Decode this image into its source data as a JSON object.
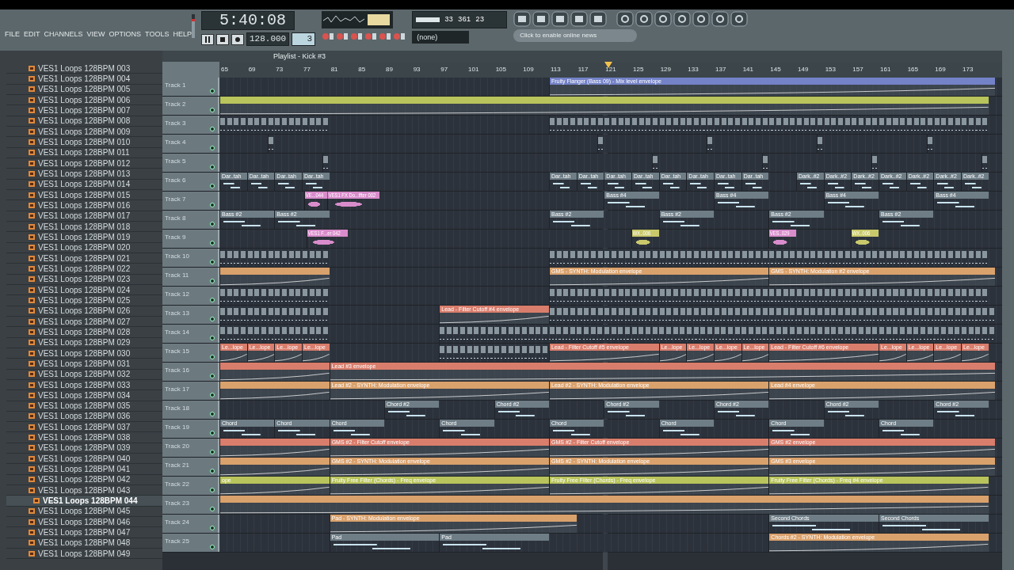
{
  "menu": [
    "FILE",
    "EDIT",
    "CHANNELS",
    "VIEW",
    "OPTIONS",
    "TOOLS",
    "HELP"
  ],
  "volume": {
    "level": 0.8
  },
  "time": "5:40:08",
  "tempo": "128.000",
  "pattern": "3",
  "cpu": {
    "a": "33",
    "b": "361",
    "c": "23"
  },
  "output": "(none)",
  "news": "Click to enable online news",
  "playlist_title": "Playlist - Kick #3",
  "browser": [
    {
      "name": "VES1 Loops 128BPM 003",
      "selected": false
    },
    {
      "name": "VES1 Loops 128BPM 004",
      "selected": false
    },
    {
      "name": "VES1 Loops 128BPM 005",
      "selected": false
    },
    {
      "name": "VES1 Loops 128BPM 006",
      "selected": false
    },
    {
      "name": "VES1 Loops 128BPM 007",
      "selected": false
    },
    {
      "name": "VES1 Loops 128BPM 008",
      "selected": false
    },
    {
      "name": "VES1 Loops 128BPM 009",
      "selected": false
    },
    {
      "name": "VES1 Loops 128BPM 010",
      "selected": false
    },
    {
      "name": "VES1 Loops 128BPM 011",
      "selected": false
    },
    {
      "name": "VES1 Loops 128BPM 012",
      "selected": false
    },
    {
      "name": "VES1 Loops 128BPM 013",
      "selected": false
    },
    {
      "name": "VES1 Loops 128BPM 014",
      "selected": false
    },
    {
      "name": "VES1 Loops 128BPM 015",
      "selected": false
    },
    {
      "name": "VES1 Loops 128BPM 016",
      "selected": false
    },
    {
      "name": "VES1 Loops 128BPM 017",
      "selected": false
    },
    {
      "name": "VES1 Loops 128BPM 018",
      "selected": false
    },
    {
      "name": "VES1 Loops 128BPM 019",
      "selected": false
    },
    {
      "name": "VES1 Loops 128BPM 020",
      "selected": false
    },
    {
      "name": "VES1 Loops 128BPM 021",
      "selected": false
    },
    {
      "name": "VES1 Loops 128BPM 022",
      "selected": false
    },
    {
      "name": "VES1 Loops 128BPM 023",
      "selected": false
    },
    {
      "name": "VES1 Loops 128BPM 024",
      "selected": false
    },
    {
      "name": "VES1 Loops 128BPM 025",
      "selected": false
    },
    {
      "name": "VES1 Loops 128BPM 026",
      "selected": false
    },
    {
      "name": "VES1 Loops 128BPM 027",
      "selected": false
    },
    {
      "name": "VES1 Loops 128BPM 028",
      "selected": false
    },
    {
      "name": "VES1 Loops 128BPM 029",
      "selected": false
    },
    {
      "name": "VES1 Loops 128BPM 030",
      "selected": false
    },
    {
      "name": "VES1 Loops 128BPM 031",
      "selected": false
    },
    {
      "name": "VES1 Loops 128BPM 032",
      "selected": false
    },
    {
      "name": "VES1 Loops 128BPM 033",
      "selected": false
    },
    {
      "name": "VES1 Loops 128BPM 034",
      "selected": false
    },
    {
      "name": "VES1 Loops 128BPM 035",
      "selected": false
    },
    {
      "name": "VES1 Loops 128BPM 036",
      "selected": false
    },
    {
      "name": "VES1 Loops 128BPM 037",
      "selected": false
    },
    {
      "name": "VES1 Loops 128BPM 038",
      "selected": false
    },
    {
      "name": "VES1 Loops 128BPM 039",
      "selected": false
    },
    {
      "name": "VES1 Loops 128BPM 040",
      "selected": false
    },
    {
      "name": "VES1 Loops 128BPM 041",
      "selected": false
    },
    {
      "name": "VES1 Loops 128BPM 042",
      "selected": false
    },
    {
      "name": "VES1 Loops 128BPM 043",
      "selected": false
    },
    {
      "name": "VES1 Loops 128BPM 044",
      "selected": true
    },
    {
      "name": "VES1 Loops 128BPM 045",
      "selected": false
    },
    {
      "name": "VES1 Loops 128BPM 046",
      "selected": false
    },
    {
      "name": "VES1 Loops 128BPM 047",
      "selected": false
    },
    {
      "name": "VES1 Loops 128BPM 048",
      "selected": false
    },
    {
      "name": "VES1 Loops 128BPM 049",
      "selected": false
    }
  ],
  "ruler": [
    "65",
    "69",
    "73",
    "77",
    "81",
    "85",
    "89",
    "93",
    "97",
    "101",
    "105",
    "109",
    "113",
    "117",
    "121",
    "125",
    "129",
    "133",
    "137",
    "141",
    "145",
    "149",
    "153",
    "157",
    "161",
    "165",
    "169",
    "173"
  ],
  "playhead": {
    "level": 0.497
  },
  "tracks": [
    {
      "name": "Track 1",
      "clips": [
        {
          "kind": "auto",
          "label": "Fruity Flanger (Bass 09) - Mix level envelope",
          "color": "#7482c8"
        }
      ]
    },
    {
      "name": "Track 2",
      "clips": [
        {
          "kind": "auto",
          "color": "#b9c45c"
        }
      ]
    },
    {
      "name": "Track 3",
      "clips": [
        {
          "kind": "blocks",
          "color": "#8a969e"
        },
        {
          "kind": "blocks",
          "color": "#8a969e"
        }
      ]
    },
    {
      "name": "Track 4",
      "clips": [
        {
          "kind": "blocks",
          "color": "#8a969e"
        },
        {
          "kind": "blocks",
          "color": "#8a969e"
        },
        {
          "kind": "blocks",
          "color": "#8a969e"
        },
        {
          "kind": "blocks",
          "color": "#8a969e"
        },
        {
          "kind": "blocks",
          "color": "#8a969e"
        }
      ]
    },
    {
      "name": "Track 5",
      "clips": [
        {
          "kind": "blocks",
          "color": "#8a969e"
        },
        {
          "kind": "blocks",
          "color": "#8a969e"
        },
        {
          "kind": "blocks",
          "color": "#8a969e"
        },
        {
          "kind": "blocks",
          "color": "#8a969e"
        },
        {
          "kind": "blocks",
          "color": "#8a969e"
        }
      ]
    },
    {
      "name": "Track 6",
      "clips": [
        {
          "kind": "pattern",
          "label": "Dar..tah",
          "color": "#6e7d86"
        },
        {
          "kind": "pattern",
          "label": "Dar..tah",
          "color": "#6e7d86"
        },
        {
          "kind": "pattern",
          "label": "Dar..tah",
          "color": "#6e7d86"
        },
        {
          "kind": "pattern",
          "label": "Dar..tah",
          "color": "#6e7d86"
        },
        {
          "kind": "pattern",
          "label": "Dar..tah",
          "color": "#6e7d86"
        },
        {
          "kind": "pattern",
          "label": "Dar..tah",
          "color": "#6e7d86"
        },
        {
          "kind": "pattern",
          "label": "Dar..tah",
          "color": "#6e7d86"
        },
        {
          "kind": "pattern",
          "label": "Dar..tah",
          "color": "#6e7d86"
        },
        {
          "kind": "pattern",
          "label": "Dar..tah",
          "color": "#6e7d86"
        },
        {
          "kind": "pattern",
          "label": "Dar..tah",
          "color": "#6e7d86"
        },
        {
          "kind": "pattern",
          "label": "Dar..tah",
          "color": "#6e7d86"
        },
        {
          "kind": "pattern",
          "label": "Dar..tah",
          "color": "#6e7d86"
        },
        {
          "kind": "pattern",
          "label": "Dark..#2",
          "color": "#6e7d86"
        },
        {
          "kind": "pattern",
          "label": "Dark..#2",
          "color": "#6e7d86"
        },
        {
          "kind": "pattern",
          "label": "Dark..#2",
          "color": "#6e7d86"
        },
        {
          "kind": "pattern",
          "label": "Dark..#2",
          "color": "#6e7d86"
        },
        {
          "kind": "pattern",
          "label": "Dark..#2",
          "color": "#6e7d86"
        },
        {
          "kind": "pattern",
          "label": "Dark..#2",
          "color": "#6e7d86"
        },
        {
          "kind": "pattern",
          "label": "Dark..#2",
          "color": "#6e7d86"
        }
      ]
    },
    {
      "name": "Track 7",
      "clips": [
        {
          "kind": "audio",
          "label": "VE...044",
          "color": "#d98ccb"
        },
        {
          "kind": "audio",
          "label": "VES1 FX Do...ffter 002",
          "color": "#d98ccb"
        },
        {
          "kind": "pattern",
          "label": "Bass #4",
          "color": "#6e7d86"
        },
        {
          "kind": "pattern",
          "label": "Bass #4",
          "color": "#6e7d86"
        },
        {
          "kind": "pattern",
          "label": "Bass #4",
          "color": "#6e7d86"
        },
        {
          "kind": "pattern",
          "label": "Bass #4",
          "color": "#6e7d86"
        }
      ]
    },
    {
      "name": "Track 8",
      "clips": [
        {
          "kind": "pattern",
          "label": "Bass #2",
          "color": "#6e7d86"
        },
        {
          "kind": "pattern",
          "label": "Bass #2",
          "color": "#6e7d86"
        },
        {
          "kind": "pattern",
          "label": "Bass #2",
          "color": "#6e7d86"
        },
        {
          "kind": "pattern",
          "label": "Bass #2",
          "color": "#6e7d86"
        },
        {
          "kind": "pattern",
          "label": "Bass #2",
          "color": "#6e7d86"
        },
        {
          "kind": "pattern",
          "label": "Bass #2",
          "color": "#6e7d86"
        }
      ]
    },
    {
      "name": "Track 9",
      "clips": [
        {
          "kind": "audio",
          "label": "VES1 F...er 042",
          "color": "#d98ccb"
        },
        {
          "kind": "audio",
          "label": "WX..006",
          "color": "#c9c96c"
        },
        {
          "kind": "audio",
          "label": "VES..029",
          "color": "#d98ccb"
        },
        {
          "kind": "audio",
          "label": "WX..006",
          "color": "#c9c96c"
        }
      ]
    },
    {
      "name": "Track 10",
      "clips": [
        {
          "kind": "blocks",
          "color": "#8a969e"
        },
        {
          "kind": "blocks",
          "color": "#8a969e"
        }
      ]
    },
    {
      "name": "Track 11",
      "clips": [
        {
          "kind": "auto",
          "color": "#d9a16c"
        },
        {
          "kind": "auto",
          "label": "GMS - SYNTH: Modulation envelope",
          "color": "#d9a16c"
        },
        {
          "kind": "auto",
          "label": "GMS - SYNTH: Modulation #2 envelope",
          "color": "#d9a16c"
        }
      ]
    },
    {
      "name": "Track 12",
      "clips": [
        {
          "kind": "blocks",
          "color": "#8a969e"
        },
        {
          "kind": "blocks",
          "color": "#8a969e"
        }
      ]
    },
    {
      "name": "Track 13",
      "clips": [
        {
          "kind": "blocks",
          "color": "#8a969e"
        },
        {
          "kind": "auto",
          "label": "Lead - Filter Cutoff #4 envelope",
          "color": "#d97d6c"
        },
        {
          "kind": "blocks",
          "color": "#8a969e"
        }
      ]
    },
    {
      "name": "Track 14",
      "clips": [
        {
          "kind": "blocks",
          "color": "#8a969e"
        },
        {
          "kind": "blocks",
          "color": "#8a969e"
        }
      ]
    },
    {
      "name": "Track 15",
      "clips": [
        {
          "kind": "auto",
          "label": "Le...lope",
          "color": "#d97d6c"
        },
        {
          "kind": "auto",
          "label": "Le...lope",
          "color": "#d97d6c"
        },
        {
          "kind": "auto",
          "label": "Le...lope",
          "color": "#d97d6c"
        },
        {
          "kind": "auto",
          "label": "Le...lope",
          "color": "#d97d6c"
        },
        {
          "kind": "blocks",
          "color": "#8a969e"
        },
        {
          "kind": "auto",
          "label": "Lead - Filter Cutoff #5 envelope",
          "color": "#d97d6c"
        },
        {
          "kind": "auto",
          "label": "Le...lope",
          "color": "#d97d6c"
        },
        {
          "kind": "auto",
          "label": "Le...lope",
          "color": "#d97d6c"
        },
        {
          "kind": "auto",
          "label": "Le...lope",
          "color": "#d97d6c"
        },
        {
          "kind": "auto",
          "label": "Le...lope",
          "color": "#d97d6c"
        },
        {
          "kind": "auto",
          "label": "Lead - Filter Cutoff #6 envelope",
          "color": "#d97d6c"
        },
        {
          "kind": "auto",
          "label": "Le...lope",
          "color": "#d97d6c"
        },
        {
          "kind": "auto",
          "label": "Le...lope",
          "color": "#d97d6c"
        },
        {
          "kind": "auto",
          "label": "Le...lope",
          "color": "#d97d6c"
        },
        {
          "kind": "auto",
          "label": "Le...lope",
          "color": "#d97d6c"
        }
      ]
    },
    {
      "name": "Track 16",
      "clips": [
        {
          "kind": "auto",
          "color": "#d97d6c"
        },
        {
          "kind": "auto",
          "label": "Lead #3 envelope",
          "color": "#d97d6c"
        }
      ]
    },
    {
      "name": "Track 17",
      "clips": [
        {
          "kind": "auto",
          "color": "#d9a16c"
        },
        {
          "kind": "auto",
          "label": "Lead #2 - SYNTH: Modulation envelope",
          "color": "#d9a16c"
        },
        {
          "kind": "auto",
          "label": "Lead #2 - SYNTH: Modulation envelope",
          "color": "#d9a16c"
        },
        {
          "kind": "auto",
          "label": "Lead #4 envelope",
          "color": "#d9a16c"
        }
      ]
    },
    {
      "name": "Track 18",
      "clips": [
        {
          "kind": "pattern",
          "label": "Chord #2",
          "color": "#6e7d86"
        },
        {
          "kind": "pattern",
          "label": "Chord #2",
          "color": "#6e7d86"
        },
        {
          "kind": "pattern",
          "label": "Chord #2",
          "color": "#6e7d86"
        },
        {
          "kind": "pattern",
          "label": "Chord #2",
          "color": "#6e7d86"
        },
        {
          "kind": "pattern",
          "label": "Chord #2",
          "color": "#6e7d86"
        },
        {
          "kind": "pattern",
          "label": "Chord #2",
          "color": "#6e7d86"
        }
      ]
    },
    {
      "name": "Track 19",
      "clips": [
        {
          "kind": "pattern",
          "label": "Chord",
          "color": "#6e7d86"
        },
        {
          "kind": "pattern",
          "label": "Chord",
          "color": "#6e7d86"
        },
        {
          "kind": "pattern",
          "label": "Chord",
          "color": "#6e7d86"
        },
        {
          "kind": "pattern",
          "label": "Chord",
          "color": "#6e7d86"
        },
        {
          "kind": "pattern",
          "label": "Chord",
          "color": "#6e7d86"
        },
        {
          "kind": "pattern",
          "label": "Chord",
          "color": "#6e7d86"
        },
        {
          "kind": "pattern",
          "label": "Chord",
          "color": "#6e7d86"
        },
        {
          "kind": "pattern",
          "label": "Chord",
          "color": "#6e7d86"
        }
      ]
    },
    {
      "name": "Track 20",
      "clips": [
        {
          "kind": "auto",
          "color": "#d97d6c"
        },
        {
          "kind": "auto",
          "label": "GMS #2 - Filter Cutoff envelope",
          "color": "#d97d6c"
        },
        {
          "kind": "auto",
          "label": "GMS #2 - Filter Cutoff envelope",
          "color": "#d97d6c"
        },
        {
          "kind": "auto",
          "label": "GMS #2 envelope",
          "color": "#d97d6c"
        }
      ]
    },
    {
      "name": "Track 21",
      "clips": [
        {
          "kind": "auto",
          "color": "#d9a16c"
        },
        {
          "kind": "auto",
          "label": "GMS #2 - SYNTH: Modulation envelope",
          "color": "#d9a16c"
        },
        {
          "kind": "auto",
          "label": "GMS #2 - SYNTH: Modulation envelope",
          "color": "#d9a16c"
        },
        {
          "kind": "auto",
          "label": "GMS #3 envelope",
          "color": "#d9a16c"
        }
      ]
    },
    {
      "name": "Track 22",
      "clips": [
        {
          "kind": "auto",
          "label": "ope",
          "color": "#b9c45c"
        },
        {
          "kind": "auto",
          "label": "Fruity Free Filter (Chords) - Freq envelope",
          "color": "#b9c45c"
        },
        {
          "kind": "auto",
          "label": "Fruity Free Filter (Chords) - Freq envelope",
          "color": "#b9c45c"
        },
        {
          "kind": "auto",
          "label": "Fruity Free Filter (Chords) - Freq #4 envelope",
          "color": "#b9c45c"
        }
      ]
    },
    {
      "name": "Track 23",
      "clips": [
        {
          "kind": "auto",
          "color": "#d9a16c"
        }
      ]
    },
    {
      "name": "Track 24",
      "clips": [
        {
          "kind": "auto",
          "label": "Pad - SYNTH: Modulation envelope",
          "color": "#d9a16c"
        },
        {
          "kind": "pattern",
          "label": "Second Chords",
          "color": "#6e7d86"
        },
        {
          "kind": "pattern",
          "label": "Second Chords",
          "color": "#6e7d86"
        }
      ]
    },
    {
      "name": "Track 25",
      "clips": [
        {
          "kind": "pattern",
          "label": "Pad",
          "color": "#6e7d86"
        },
        {
          "kind": "pattern",
          "label": "Pad",
          "color": "#6e7d86"
        },
        {
          "kind": "auto",
          "label": "Chords #2 - SYNTH: Modulation envelope",
          "color": "#d9a16c"
        }
      ]
    }
  ]
}
